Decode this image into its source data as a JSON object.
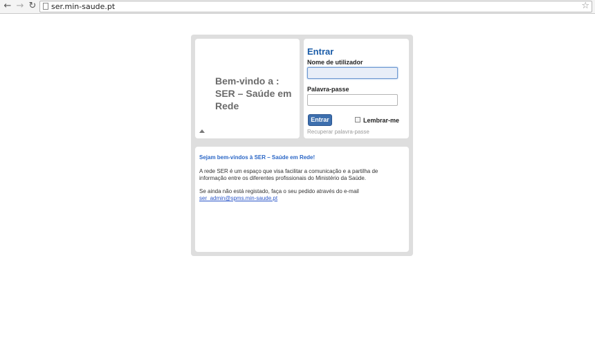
{
  "browser": {
    "url": "ser.min-saude.pt",
    "back_icon": "←",
    "forward_icon": "→",
    "reload_icon": "↻",
    "star_icon": "☆"
  },
  "welcome": {
    "text": "Bem-vindo a : SER – Saúde em Rede"
  },
  "login": {
    "title": "Entrar",
    "username_label": "Nome de utilizador",
    "username_value": "",
    "password_label": "Palavra-passe",
    "password_value": "",
    "submit_label": "Entrar",
    "remember_label": "Lembrar-me",
    "recover_link": "Recuperar palavra-passe"
  },
  "info": {
    "heading": "Sejam bem-vindos à SER – Saúde em Rede!",
    "paragraph1": "A rede SER é um espaço que visa facilitar a comunicação e a partilha de informação entre os diferentes profissionais do Ministério da Saúde.",
    "paragraph2": "Se ainda não está registado, faça o seu pedido através do e-mail",
    "email": "ser_admin@spms.min-saude.pt"
  },
  "colors": {
    "title_blue": "#1a5ca8",
    "heading_blue": "#2a66c6",
    "frame_gray": "#dedede",
    "button_blue": "#3d6fae"
  }
}
